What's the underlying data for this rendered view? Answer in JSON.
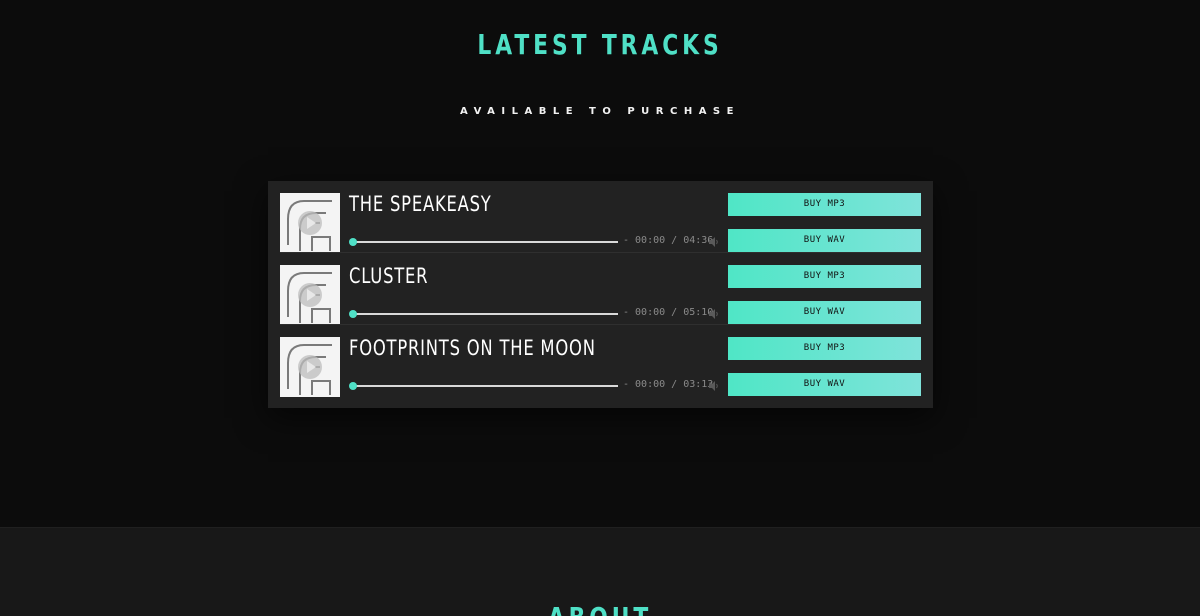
{
  "tracks_section": {
    "title": "LATEST TRACKS",
    "subtitle": "AVAILABLE TO PURCHASE"
  },
  "tracks": [
    {
      "title": "THE SPEAKEASY",
      "time": "- 00:00 / 04:36",
      "progress": 0,
      "buy_mp3": "BUY MP3",
      "buy_wav": "BUY WAV"
    },
    {
      "title": "CLUSTER",
      "time": "- 00:00 / 05:10",
      "progress": 0,
      "buy_mp3": "BUY MP3",
      "buy_wav": "BUY WAV"
    },
    {
      "title": "FOOTPRINTS ON THE MOON",
      "time": "- 00:00 / 03:13",
      "progress": 0,
      "buy_mp3": "BUY MP3",
      "buy_wav": "BUY WAV"
    }
  ],
  "about_section": {
    "title": "ABOUT"
  },
  "colors": {
    "accent": "#4fe0c6",
    "background": "#0c0c0c",
    "player_background": "#222222",
    "about_background": "#181818"
  },
  "icons": {
    "artwork": "logo-artwork-icon",
    "volume": "volume-icon"
  }
}
